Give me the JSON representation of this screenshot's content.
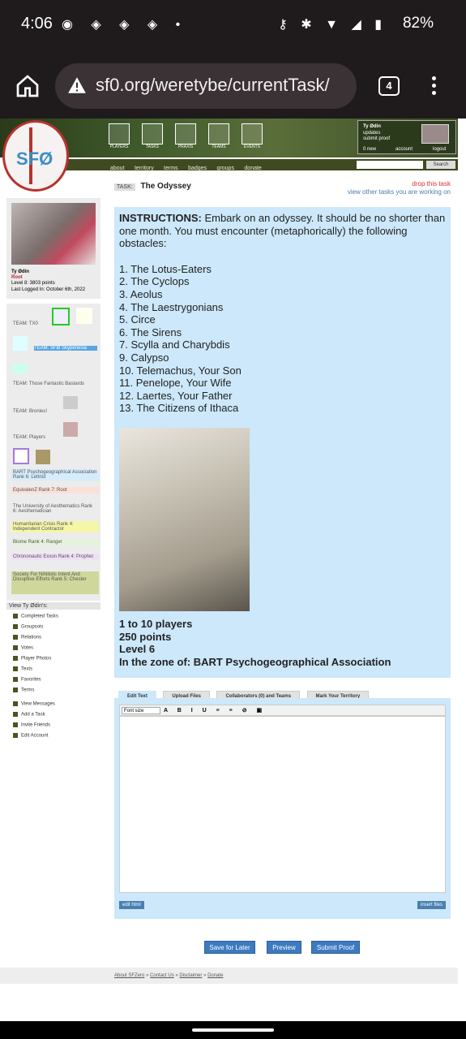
{
  "status": {
    "time": "4:06",
    "battery": "82%",
    "notif_icons": [
      "signal-icon",
      "discord-icon",
      "discord-icon",
      "discord-icon",
      "dot-icon"
    ],
    "sys_icons": [
      "vpn-key-icon",
      "bluetooth-icon",
      "wifi-icon",
      "cell-signal-icon",
      "battery-icon"
    ]
  },
  "browser": {
    "url": "sf0.org/weretybe/currentTask/",
    "tab_count": "4"
  },
  "site": {
    "logo_text": "SFØ",
    "nav_icons": [
      "PLAYERS",
      "TASKS",
      "PRAXIS",
      "TEAMS",
      "EVENTS"
    ],
    "subnav": [
      "about",
      "territory",
      "terms",
      "badges",
      "groups",
      "donate"
    ],
    "search_label": "Search",
    "userbox": {
      "name": "Ty Ødin",
      "links": [
        "updates",
        "submit proof"
      ],
      "new_label": "0 new",
      "account": "account",
      "logout": "logout"
    }
  },
  "task": {
    "tag": "TASK:",
    "title": "The Odyssey",
    "drop_link": "drop this task",
    "view_other": "view other tasks you are working on",
    "instructions_label": "INSTRUCTIONS:",
    "instructions": " Embark on an odyssey. It should be no shorter than one month. You must encounter (metaphorically) the following obstacles:",
    "obstacles": [
      "1. The Lotus-Eaters",
      "2. The Cyclops",
      "3. Aeolus",
      "4. The Laestrygonians",
      "5. Circe",
      "6. The Sirens",
      "7. Scylla and Charybdis",
      "9. Calypso",
      "10. Telemachus, Your Son",
      "11. Penelope, Your Wife",
      "12. Laertes, Your Father",
      "13. The Citizens of Ithaca"
    ],
    "players": "1 to 10 players",
    "points": "250 points",
    "level": "Level 6",
    "zone": "In the zone of: BART Psychogeographical Association"
  },
  "profile": {
    "name": "Ty Ødin",
    "role": "Root",
    "level": "Level 8: 3803 points",
    "last_login": "Last Logged In: October 6th, 2022"
  },
  "teams": [
    "TEAM: TX0",
    "TEAM: SFØ Skypenesia",
    "TEAM: Those Fantastic Bastards",
    "TEAM: Bronies!",
    "TEAM: Players"
  ],
  "ranks": [
    {
      "text": "BART Psychogeographical Association Rank 6: Lettrist",
      "color": "#d6ecfb"
    },
    {
      "text": "EquivalenZ Rank 7: Root",
      "color": "#fbe0d8"
    },
    {
      "text": "The University of Aesthematics Rank 6: Aesthematician",
      "color": "#ececec"
    },
    {
      "text": "Humanitarian Crisis Rank 4: Independent Contractor",
      "color": "#f5f7a8"
    },
    {
      "text": "Biome Rank 4: Ranger",
      "color": "#e4f3da"
    },
    {
      "text": "Chrononautic Exxon Rank 4: Prophet",
      "color": "#f0e0f4"
    },
    {
      "text": "Society For Nihilistic Intent And Disruptive Efforts Rank 5: Chester",
      "color": "#cfd89a"
    }
  ],
  "view_list": {
    "header": "View Ty Ødin's:",
    "items": [
      "Completed Tasks",
      "Groupsois",
      "Relations",
      "Votes",
      "Player Photos",
      "Texts",
      "Favorites",
      "Terms"
    ],
    "items2": [
      "View Messages",
      "Add a Task",
      "Invite Friends",
      "Edit Account"
    ]
  },
  "editor": {
    "tabs": [
      "Edit Text",
      "Upload Files",
      "Collaborators (0) and Teams",
      "Mark Your Territory"
    ],
    "font_size": "Font size",
    "edit_html": "edit html",
    "insert_files": "insert files"
  },
  "actions": {
    "save_later": "Save for Later",
    "preview": "Preview",
    "submit": "Submit Proof"
  },
  "footer": {
    "links": [
      "About SFZero",
      "Contact Us",
      "Disclaimer",
      "Donate"
    ]
  }
}
